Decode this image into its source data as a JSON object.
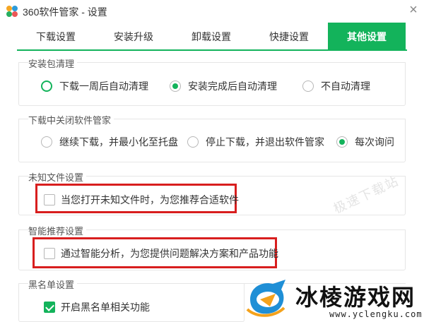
{
  "window": {
    "title": "360软件管家 - 设置",
    "close_symbol": "×"
  },
  "tabs": [
    {
      "label": "下载设置",
      "active": false
    },
    {
      "label": "安装升级",
      "active": false
    },
    {
      "label": "卸载设置",
      "active": false
    },
    {
      "label": "快捷设置",
      "active": false
    },
    {
      "label": "其他设置",
      "active": true
    }
  ],
  "sections": {
    "package_cleanup": {
      "title": "安装包清理",
      "options": [
        "下载一周后自动清理",
        "安装完成后自动清理",
        "不自动清理"
      ],
      "selected": "安装完成后自动清理"
    },
    "close_during_download": {
      "title": "下载中关闭软件管家",
      "options": [
        "继续下载，并最小化至托盘",
        "停止下载，并退出软件管家",
        "每次询问"
      ],
      "selected": "每次询问"
    },
    "unknown_files": {
      "title": "未知文件设置",
      "option": "当您打开未知文件时，为您推荐合适软件",
      "checked": false
    },
    "smart_recommend": {
      "title": "智能推荐设置",
      "option": "通过智能分析，为您提供问题解决方案和产品功能",
      "checked": false
    },
    "blacklist": {
      "title": "黑名单设置",
      "option": "开启黑名单相关功能",
      "checked": true
    }
  },
  "watermarks": {
    "diagonal_text": "极速下载站",
    "brand_name": "冰棱游戏网",
    "brand_url": "www.yclengku.com"
  },
  "colors": {
    "accent": "#13b35b",
    "highlight_box": "#d81e1e"
  }
}
